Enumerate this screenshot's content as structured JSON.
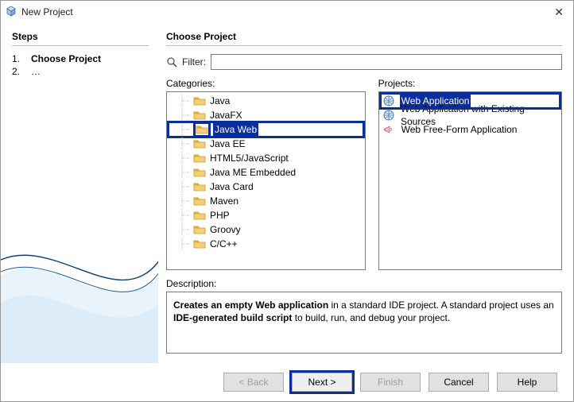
{
  "window": {
    "title": "New Project"
  },
  "steps": {
    "heading": "Steps",
    "items": [
      {
        "num": "1.",
        "label": "Choose Project",
        "bold": true
      },
      {
        "num": "2.",
        "label": "…",
        "bold": false
      }
    ]
  },
  "choose": {
    "heading": "Choose Project",
    "filter_label": "Filter:",
    "filter_value": "",
    "categories_label": "Categories:",
    "projects_label": "Projects:",
    "description_label": "Description:",
    "description_html_parts": {
      "p1_bold": "Creates an empty Web application",
      "p1_rest": " in a standard IDE project. A standard project uses an ",
      "p2_bold": "IDE-generated build script",
      "p2_rest": " to build, run, and debug your project."
    },
    "categories": [
      {
        "label": "Java",
        "selected": false
      },
      {
        "label": "JavaFX",
        "selected": false
      },
      {
        "label": "Java Web",
        "selected": true
      },
      {
        "label": "Java EE",
        "selected": false
      },
      {
        "label": "HTML5/JavaScript",
        "selected": false
      },
      {
        "label": "Java ME Embedded",
        "selected": false
      },
      {
        "label": "Java Card",
        "selected": false
      },
      {
        "label": "Maven",
        "selected": false
      },
      {
        "label": "PHP",
        "selected": false
      },
      {
        "label": "Groovy",
        "selected": false
      },
      {
        "label": "C/C++",
        "selected": false
      }
    ],
    "projects": [
      {
        "label": "Web Application",
        "icon": "globe",
        "selected": true
      },
      {
        "label": "Web Application with Existing Sources",
        "icon": "globe",
        "selected": false
      },
      {
        "label": "Web Free-Form Application",
        "icon": "megaphone",
        "selected": false
      }
    ]
  },
  "footer": {
    "back": "< Back",
    "next": "Next >",
    "finish": "Finish",
    "cancel": "Cancel",
    "help": "Help"
  }
}
